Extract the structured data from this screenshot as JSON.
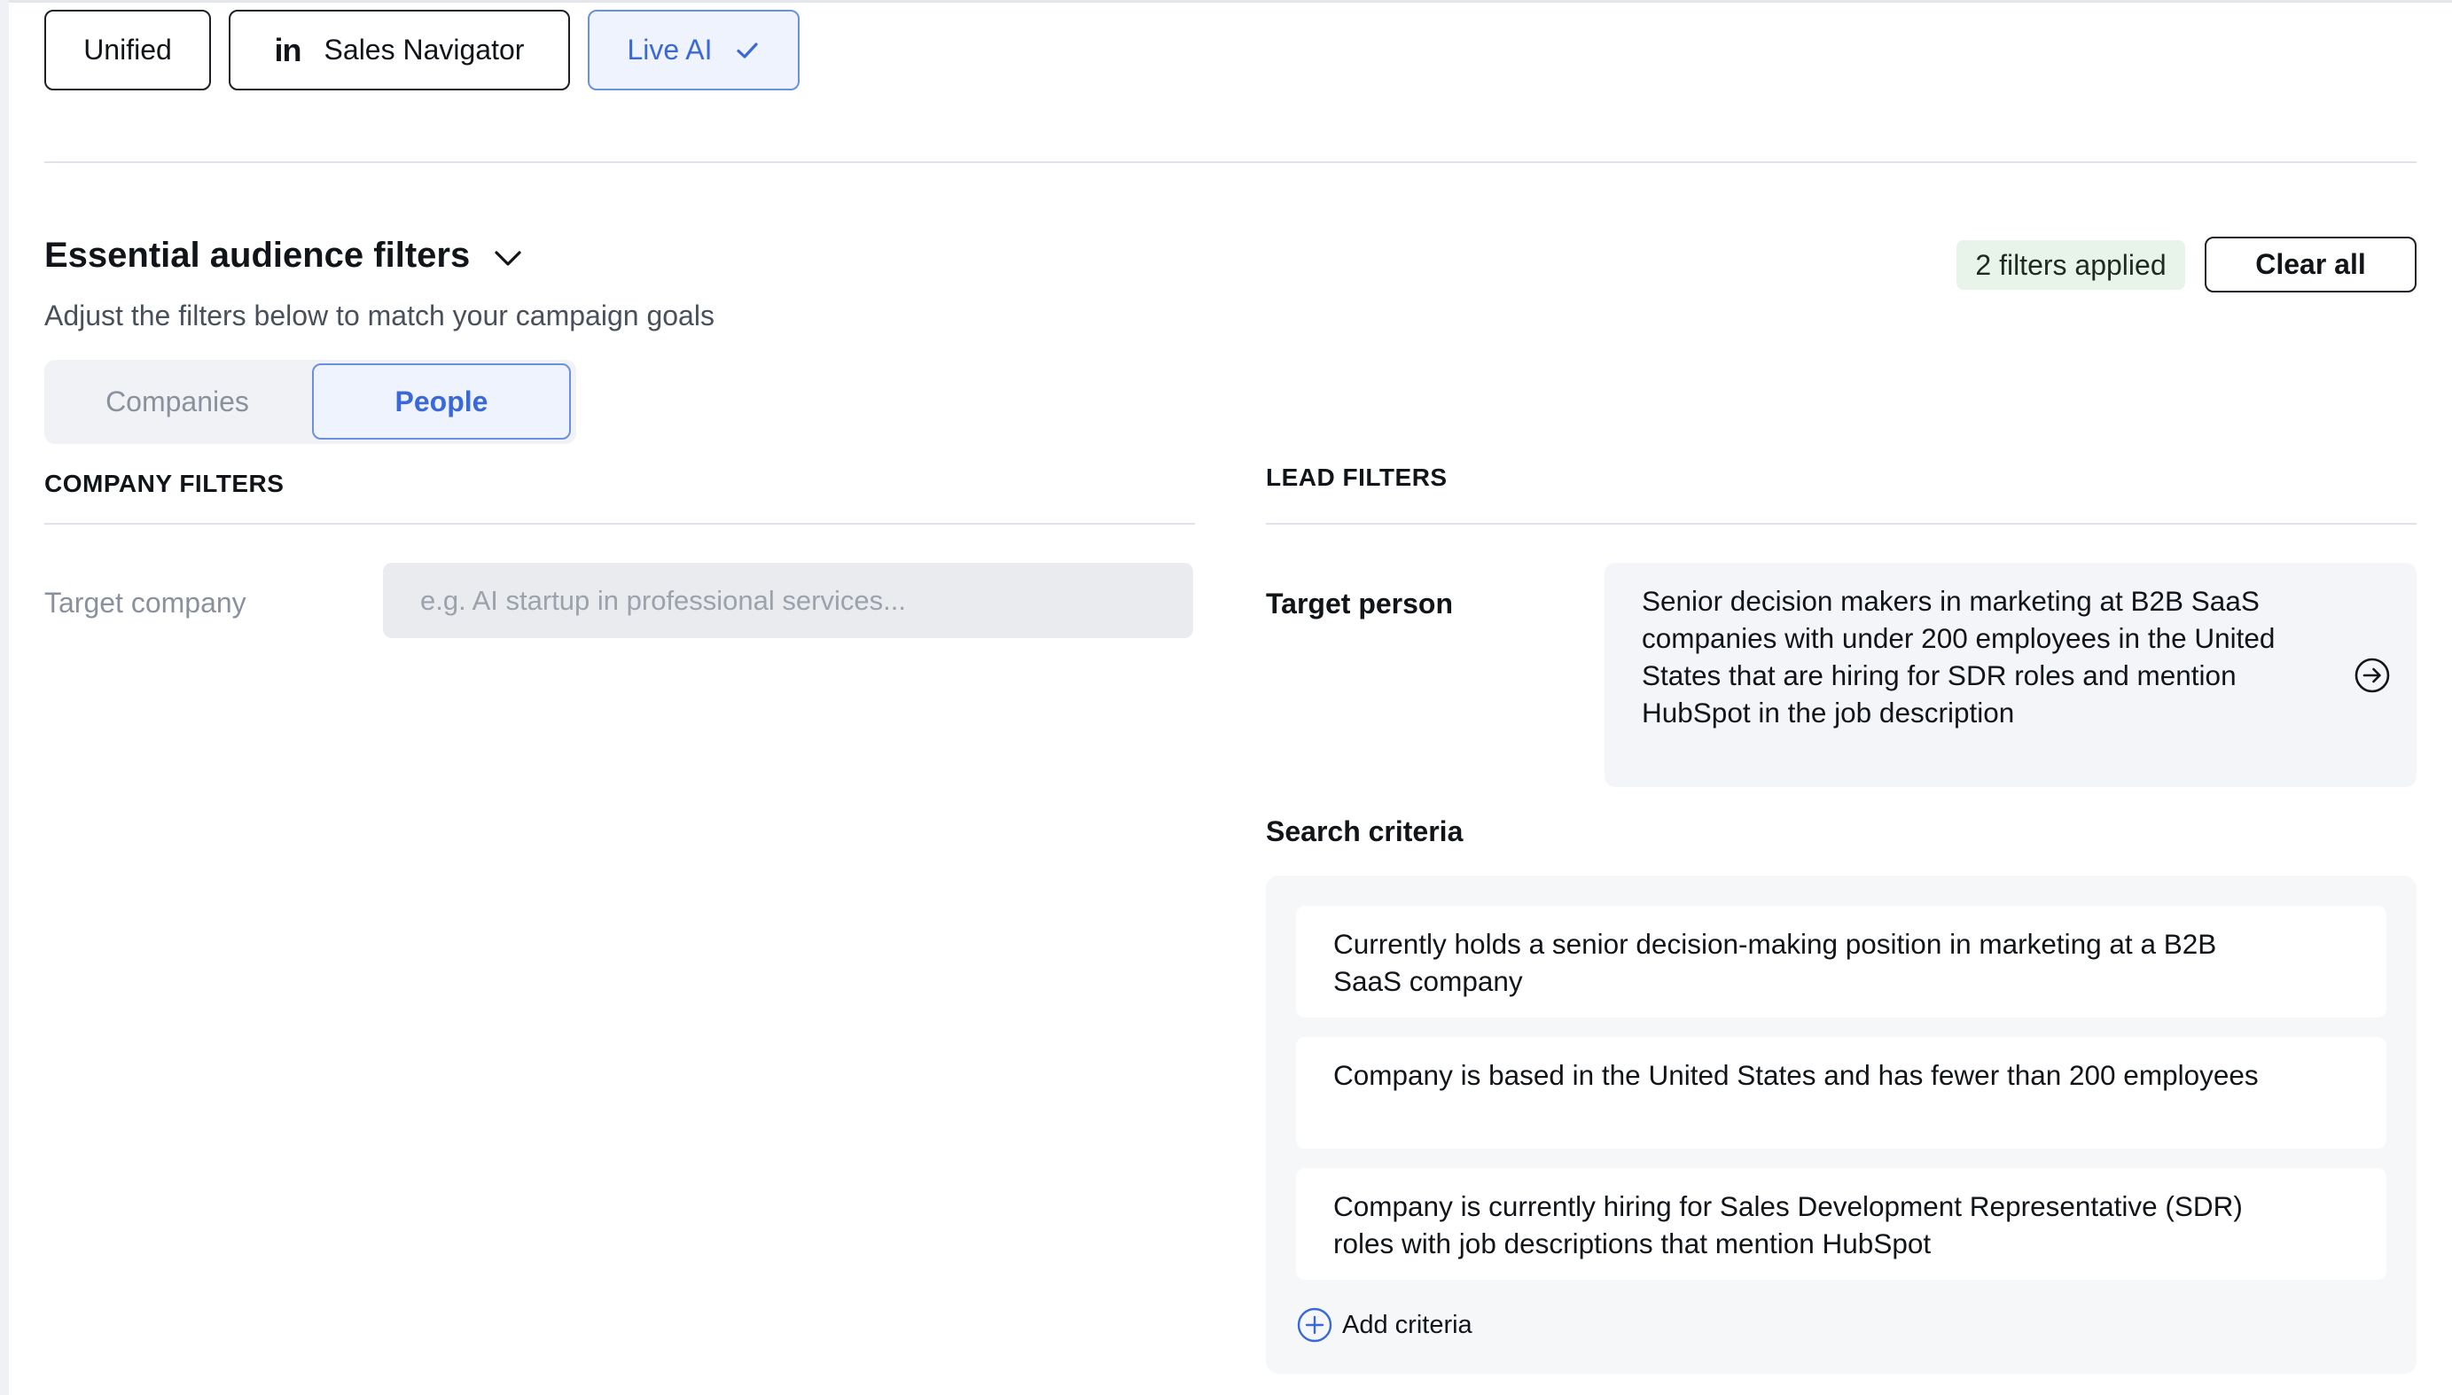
{
  "source_tabs": [
    {
      "label": "Unified",
      "active": false
    },
    {
      "label": "Sales Navigator",
      "icon": "linkedin-icon",
      "icon_text": "in",
      "active": false
    },
    {
      "label": "Live AI",
      "icon": "check-icon",
      "active": true
    }
  ],
  "section": {
    "title": "Essential audience filters",
    "subtitle": "Adjust the filters below to match your campaign goals",
    "filters_applied": "2 filters applied",
    "clear_all": "Clear all"
  },
  "audience_toggle": {
    "options": [
      "Companies",
      "People"
    ],
    "selected": "People"
  },
  "company_filters": {
    "heading": "COMPANY FILTERS",
    "target_company": {
      "label": "Target company",
      "value": "",
      "placeholder": "e.g. AI startup in professional services..."
    }
  },
  "lead_filters": {
    "heading": "LEAD FILTERS",
    "target_person": {
      "label": "Target person",
      "value": "Senior decision makers in marketing at B2B SaaS companies with under 200 employees in the United States that are hiring for SDR roles and mention HubSpot in the job description"
    },
    "search_criteria": {
      "label": "Search criteria",
      "items": [
        "Currently holds a senior decision-making position in marketing at a B2B SaaS company",
        "Company is based in the United States and has fewer than 200 employees",
        "Company is currently hiring for Sales Development Representative (SDR) roles with job descriptions that mention HubSpot"
      ],
      "add_label": "Add criteria"
    }
  },
  "colors": {
    "accent": "#3a68d8",
    "accent_border": "#6b8fe3",
    "accent_bg": "#eef3fd",
    "badge_bg": "#e8f3ea",
    "muted_text": "#8b919c"
  }
}
